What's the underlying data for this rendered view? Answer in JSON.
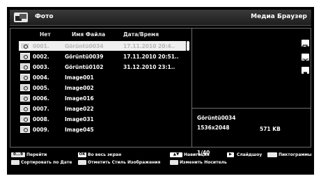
{
  "header": {
    "title": "Фото",
    "app_name": "Медиа Браузер"
  },
  "columns": {
    "number": "Нет",
    "filename": "Имя Файла",
    "datetime": "Дата/Время"
  },
  "files": [
    {
      "number": "0001.",
      "name": "Görüntü0034",
      "date": "17.11.2010 20:4..",
      "selected": true
    },
    {
      "number": "0002.",
      "name": "Görüntü0039",
      "date": "17.11.2010 20:51..",
      "selected": false
    },
    {
      "number": "0003.",
      "name": "Görüntü0102",
      "date": "31.12.2010 23:1..",
      "selected": false
    },
    {
      "number": "0004.",
      "name": "Image001",
      "date": "",
      "selected": false
    },
    {
      "number": "0005.",
      "name": "Image002",
      "date": "",
      "selected": false
    },
    {
      "number": "0006.",
      "name": "Image016",
      "date": "",
      "selected": false
    },
    {
      "number": "0007.",
      "name": "Image022",
      "date": "",
      "selected": false
    },
    {
      "number": "0008.",
      "name": "Image031",
      "date": "",
      "selected": false
    },
    {
      "number": "0009.",
      "name": "Image045",
      "date": "",
      "selected": false
    }
  ],
  "details": {
    "filename": "Görüntü0034",
    "resolution": "1536x2048",
    "size": "571 KB",
    "position": "1/40"
  },
  "side_icons": [
    "repeat-icon",
    "shuffle-icon",
    "stop-icon"
  ],
  "footer": {
    "row1": [
      {
        "key": "0...9",
        "label": "Перейти"
      },
      {
        "key": "OK",
        "label": "Во весь экран"
      },
      {
        "key": "▲▼",
        "label": "Навигация"
      },
      {
        "key": "▶",
        "label": "Слайдшоу"
      },
      {
        "key": "",
        "label": "Пиктограммы"
      }
    ],
    "row2": [
      {
        "key": "",
        "label": "Сортировать по Дате"
      },
      {
        "key": "",
        "label": "Отметить Стиль Изображения"
      },
      {
        "key": "",
        "label": "Изменить Носитель"
      }
    ]
  }
}
